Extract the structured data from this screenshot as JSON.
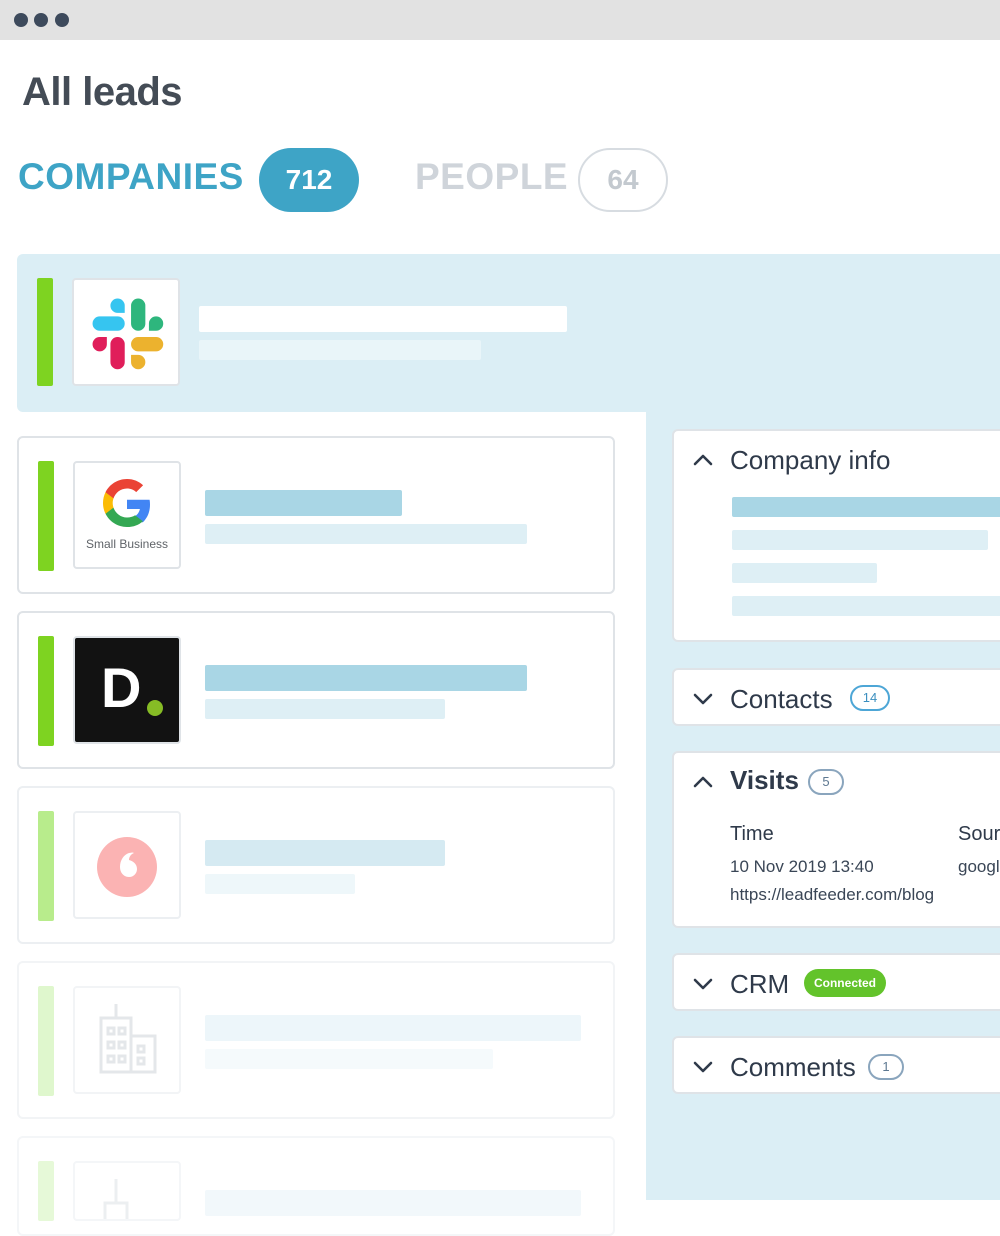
{
  "page": {
    "title": "All leads"
  },
  "tabs": {
    "companies": {
      "label": "COMPANIES",
      "count": "712"
    },
    "people": {
      "label": "PEOPLE",
      "count": "64"
    }
  },
  "leads": [
    {
      "company_logo": "slack-logo",
      "status": "selected",
      "accent_color": "#7ed321"
    },
    {
      "company_logo": "google-small-business-logo",
      "logo_text": "Small Business",
      "accent_color": "#7ed321"
    },
    {
      "company_logo": "deloitte-digital-logo",
      "logo_text": "D",
      "accent_color": "#7ed321"
    },
    {
      "company_logo": "vodafone-logo",
      "accent_color": "#b8ec8c"
    },
    {
      "company_logo": "building-icon",
      "accent_color": "#dff7cd"
    },
    {
      "company_logo": "building-icon",
      "accent_color": "#e6f9d8"
    }
  ],
  "detail": {
    "company_info": {
      "title": "Company info"
    },
    "contacts": {
      "title": "Contacts",
      "count": "14"
    },
    "visits": {
      "title": "Visits",
      "count": "5",
      "columns": [
        "Time",
        "Sour"
      ],
      "rows": [
        {
          "time": "10 Nov 2019 13:40",
          "url": "https://leadfeeder.com/blog",
          "source": "google"
        }
      ]
    },
    "crm": {
      "title": "CRM",
      "status": "Connected"
    },
    "comments": {
      "title": "Comments",
      "count": "1"
    }
  },
  "colors": {
    "accent_blue": "#3ea4c6",
    "selected_bg": "#dbeef5",
    "skeleton_blue": "#a9d6e5",
    "skeleton_light": "#deeff5",
    "accent_green": "#7ed321",
    "connected_green": "#63c32b"
  }
}
